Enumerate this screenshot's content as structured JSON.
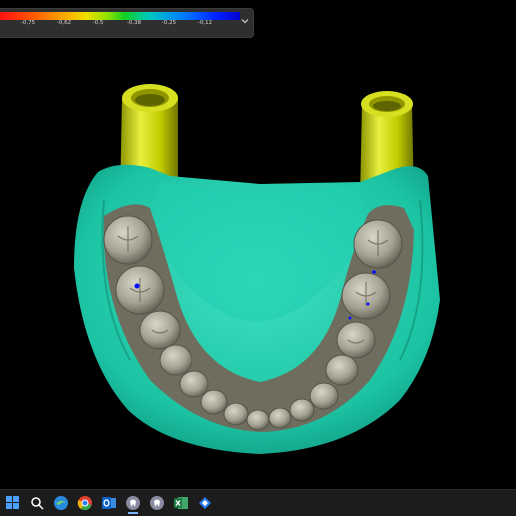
{
  "legend": {
    "ticks": [
      "-0,75",
      "-0,62",
      "-0,5",
      "-0,38",
      "-0,25",
      "-0,12"
    ],
    "gradient_colors": [
      "#ff1010",
      "#ff9800",
      "#f0e000",
      "#10d020",
      "#00c8c0",
      "#0080ff",
      "#0000d0"
    ],
    "dropdown_icon": "chevron-down-icon"
  },
  "scene": {
    "colors": {
      "background": "#000000",
      "model_base": "#1fc8a8",
      "implant_cylinders": "#c8d400",
      "teeth": "#a8a898",
      "deviation_marks": "#0010ff"
    }
  },
  "taskbar": {
    "icons": [
      {
        "name": "start-menu-icon",
        "color": "#4aa0ff"
      },
      {
        "name": "search-icon",
        "color": "#ffffff"
      },
      {
        "name": "edge-browser-icon",
        "color": "#2a8adf"
      },
      {
        "name": "chrome-browser-icon",
        "color": "#f2b400"
      },
      {
        "name": "outlook-icon",
        "color": "#0a64c8"
      },
      {
        "name": "dental-cad-app-icon",
        "color": "#8a8aa0"
      },
      {
        "name": "dental-cad-app-2-icon",
        "color": "#8a8aa0"
      },
      {
        "name": "excel-icon",
        "color": "#1e7a44"
      },
      {
        "name": "dropbox-icon",
        "color": "#2a7cf0"
      }
    ]
  }
}
